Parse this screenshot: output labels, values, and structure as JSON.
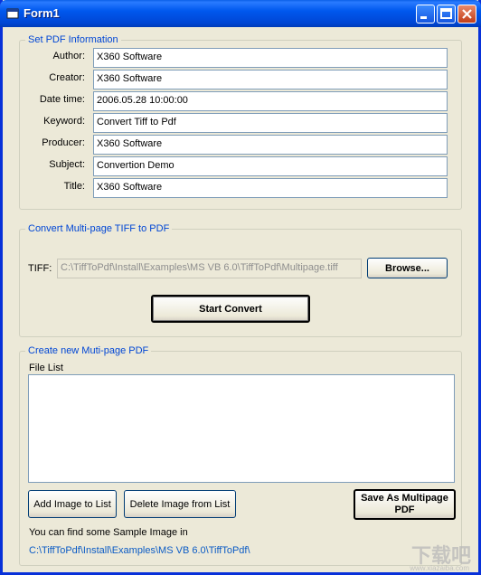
{
  "window": {
    "title": "Form1"
  },
  "set_pdf_info": {
    "legend": "Set PDF Information",
    "fields": [
      {
        "label": "Author:",
        "value": "X360 Software"
      },
      {
        "label": "Creator:",
        "value": "X360 Software"
      },
      {
        "label": "Date time:",
        "value": "2006.05.28 10:00:00"
      },
      {
        "label": "Keyword:",
        "value": "Convert Tiff to Pdf"
      },
      {
        "label": "Producer:",
        "value": "X360 Software"
      },
      {
        "label": "Subject:",
        "value": "Convertion Demo"
      },
      {
        "label": "Title:",
        "value": "X360 Software"
      }
    ]
  },
  "convert_tiff": {
    "legend": "Convert Multi-page TIFF to PDF",
    "tiff_label": "TIFF:",
    "tiff_path": "C:\\TiffToPdf\\Install\\Examples\\MS VB 6.0\\TiffToPdf\\Multipage.tiff",
    "browse_label": "Browse...",
    "start_label": "Start Convert"
  },
  "create_pdf": {
    "legend": "Create new Muti-page PDF",
    "file_list_label": "File List",
    "add_label": "Add Image to List",
    "delete_label": "Delete Image from List",
    "save_label": "Save As Multipage PDF",
    "hint": "You can find some Sample Image in",
    "sample_path": "C:\\TiffToPdf\\Install\\Examples\\MS VB 6.0\\TiffToPdf\\"
  },
  "watermark": {
    "text": "下载吧",
    "sub": "www.xiazaiba.com"
  }
}
